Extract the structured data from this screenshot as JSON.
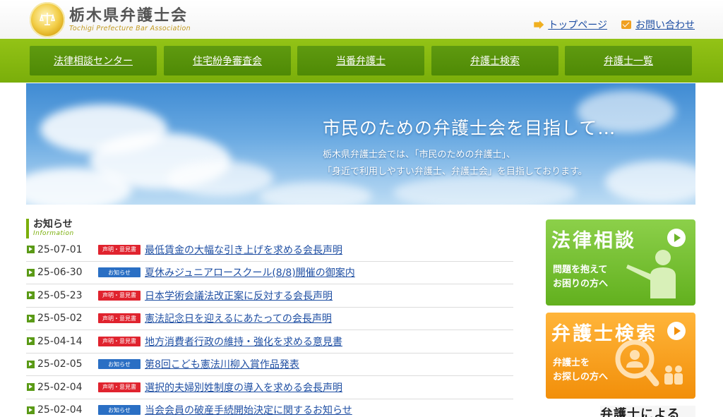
{
  "header": {
    "org_name_jp": "栃木県弁護士会",
    "org_name_en": "Tochigi Prefecture Bar Association",
    "links": [
      {
        "label": "トップページ",
        "icon": "arrow-icon"
      },
      {
        "label": "お問い合わせ",
        "icon": "mail-icon"
      }
    ]
  },
  "nav": {
    "items": [
      {
        "label": "法律相談センター"
      },
      {
        "label": "住宅紛争審査会"
      },
      {
        "label": "当番弁護士"
      },
      {
        "label": "弁護士検索"
      },
      {
        "label": "弁護士一覧"
      }
    ]
  },
  "hero": {
    "title": "市民のための弁護士会を目指して…",
    "line1": "栃木県弁護士会では、「市民のための弁護士」、",
    "line2": "「身近で利用しやすい弁護士、弁護士会」を目指しております。"
  },
  "news": {
    "title": "お知らせ",
    "subtitle": "Information",
    "items": [
      {
        "date": "25-07-01",
        "badge": "声明・意見書",
        "badge_color": "#e0232e",
        "text": "最低賃金の大幅な引き上げを求める会長声明"
      },
      {
        "date": "25-06-30",
        "badge": "お知らせ",
        "badge_color": "#2a6fc4",
        "text": "夏休みジュニアロースクール(8/8)開催の御案内"
      },
      {
        "date": "25-05-23",
        "badge": "声明・意見書",
        "badge_color": "#e0232e",
        "text": "日本学術会議法改正案に反対する会長声明"
      },
      {
        "date": "25-05-02",
        "badge": "声明・意見書",
        "badge_color": "#e0232e",
        "text": "憲法記念日を迎えるにあたっての会長声明"
      },
      {
        "date": "25-04-14",
        "badge": "声明・意見書",
        "badge_color": "#e0232e",
        "text": "地方消費者行政の維持・強化を求める意見書"
      },
      {
        "date": "25-02-05",
        "badge": "お知らせ",
        "badge_color": "#2a6fc4",
        "text": "第8回こども憲法川柳入賞作品発表"
      },
      {
        "date": "25-02-04",
        "badge": "声明・意見書",
        "badge_color": "#e0232e",
        "text": "選択的夫婦別姓制度の導入を求める会長声明"
      },
      {
        "date": "25-02-04",
        "badge": "お知らせ",
        "badge_color": "#2a6fc4",
        "text": "当会会員の破産手続開始決定に関するお知らせ"
      }
    ]
  },
  "banners": [
    {
      "title": "法律相談",
      "line1": "問題を抱えて",
      "line2": "お困りの方へ",
      "icon": "person-pointing-icon"
    },
    {
      "title": "弁護士検索",
      "line1": "弁護士を",
      "line2": "お探しの方へ",
      "icon": "magnifier-person-icon"
    }
  ],
  "bottom_banner": {
    "title": "弁護士による"
  }
}
